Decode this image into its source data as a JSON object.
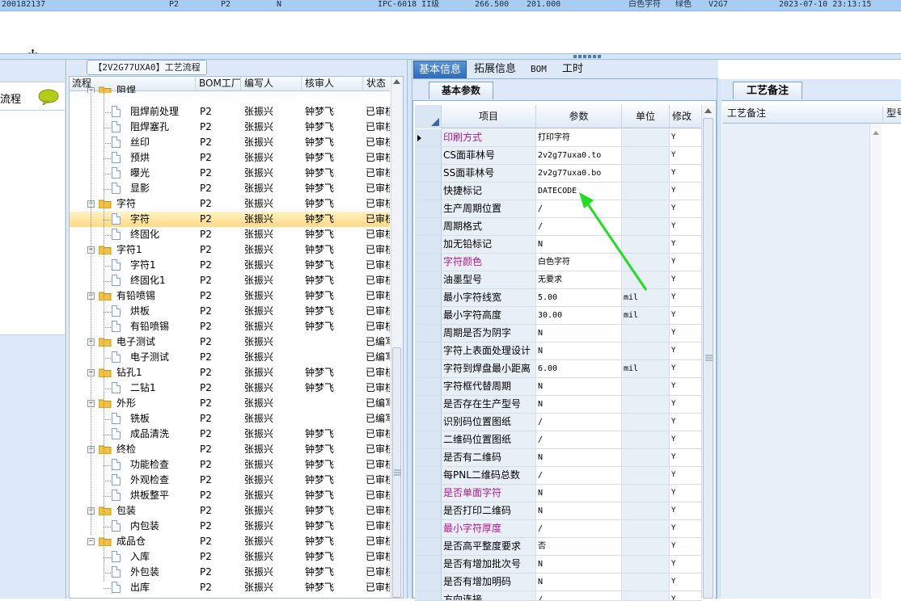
{
  "top_row": {
    "id": "200182137",
    "c1": "P2",
    "c2": "P2",
    "c3": "N",
    "model": "IPC-6018 II级",
    "v1": "266.500",
    "v2": "201.000",
    "char_color": "白色字符",
    "oil": "绿色",
    "code": "V2G7",
    "time": "2023-07-10 23:13:15"
  },
  "left_panel": {
    "label": "流程"
  },
  "tree": {
    "title": "【2V2G77UXA0】工艺流程",
    "columns": [
      "流程",
      "BOM工厂",
      "编写人",
      "核审人",
      "状态"
    ],
    "rows": [
      {
        "lvl": 0,
        "name": "阻焊",
        "bom": "",
        "writer": "",
        "reviewer": "",
        "status": "",
        "partial": true
      },
      {
        "lvl": 1,
        "name": "阻焊前处理",
        "bom": "P2",
        "writer": "张振兴",
        "reviewer": "钟梦飞",
        "status": "已审核"
      },
      {
        "lvl": 1,
        "name": "阻焊塞孔",
        "bom": "P2",
        "writer": "张振兴",
        "reviewer": "钟梦飞",
        "status": "已审核"
      },
      {
        "lvl": 1,
        "name": "丝印",
        "bom": "P2",
        "writer": "张振兴",
        "reviewer": "钟梦飞",
        "status": "已审核"
      },
      {
        "lvl": 1,
        "name": "预烘",
        "bom": "P2",
        "writer": "张振兴",
        "reviewer": "钟梦飞",
        "status": "已审核"
      },
      {
        "lvl": 1,
        "name": "曝光",
        "bom": "P2",
        "writer": "张振兴",
        "reviewer": "钟梦飞",
        "status": "已审核"
      },
      {
        "lvl": 1,
        "name": "显影",
        "bom": "P2",
        "writer": "张振兴",
        "reviewer": "钟梦飞",
        "status": "已审核"
      },
      {
        "lvl": 0,
        "name": "字符",
        "bom": "P2",
        "writer": "张振兴",
        "reviewer": "钟梦飞",
        "status": "已审核"
      },
      {
        "lvl": 1,
        "name": "字符",
        "bom": "P2",
        "writer": "张振兴",
        "reviewer": "钟梦飞",
        "status": "已审核",
        "selected": true
      },
      {
        "lvl": 1,
        "name": "终固化",
        "bom": "P2",
        "writer": "张振兴",
        "reviewer": "钟梦飞",
        "status": "已审核"
      },
      {
        "lvl": 0,
        "name": "字符1",
        "bom": "P2",
        "writer": "张振兴",
        "reviewer": "钟梦飞",
        "status": "已审核"
      },
      {
        "lvl": 1,
        "name": "字符1",
        "bom": "P2",
        "writer": "张振兴",
        "reviewer": "钟梦飞",
        "status": "已审核"
      },
      {
        "lvl": 1,
        "name": "终固化1",
        "bom": "P2",
        "writer": "张振兴",
        "reviewer": "钟梦飞",
        "status": "已审核"
      },
      {
        "lvl": 0,
        "name": "有铅喷锡",
        "bom": "P2",
        "writer": "张振兴",
        "reviewer": "钟梦飞",
        "status": "已审核"
      },
      {
        "lvl": 1,
        "name": "烘板",
        "bom": "P2",
        "writer": "张振兴",
        "reviewer": "钟梦飞",
        "status": "已审核"
      },
      {
        "lvl": 1,
        "name": "有铅喷锡",
        "bom": "P2",
        "writer": "张振兴",
        "reviewer": "钟梦飞",
        "status": "已审核"
      },
      {
        "lvl": 0,
        "name": "电子测试",
        "bom": "P2",
        "writer": "张振兴",
        "reviewer": "",
        "status": "已编写"
      },
      {
        "lvl": 1,
        "name": "电子测试",
        "bom": "P2",
        "writer": "张振兴",
        "reviewer": "",
        "status": "已编写"
      },
      {
        "lvl": 0,
        "name": "钻孔1",
        "bom": "P2",
        "writer": "张振兴",
        "reviewer": "钟梦飞",
        "status": "已审核"
      },
      {
        "lvl": 1,
        "name": "二钻1",
        "bom": "P2",
        "writer": "张振兴",
        "reviewer": "钟梦飞",
        "status": "已审核"
      },
      {
        "lvl": 0,
        "name": "外形",
        "bom": "P2",
        "writer": "张振兴",
        "reviewer": "",
        "status": "已编写"
      },
      {
        "lvl": 1,
        "name": "铣板",
        "bom": "P2",
        "writer": "张振兴",
        "reviewer": "",
        "status": "已编写"
      },
      {
        "lvl": 1,
        "name": "成品清洗",
        "bom": "P2",
        "writer": "张振兴",
        "reviewer": "钟梦飞",
        "status": "已审核"
      },
      {
        "lvl": 0,
        "name": "终检",
        "bom": "P2",
        "writer": "张振兴",
        "reviewer": "钟梦飞",
        "status": "已审核"
      },
      {
        "lvl": 1,
        "name": "功能检查",
        "bom": "P2",
        "writer": "张振兴",
        "reviewer": "钟梦飞",
        "status": "已审核"
      },
      {
        "lvl": 1,
        "name": "外观检查",
        "bom": "P2",
        "writer": "张振兴",
        "reviewer": "钟梦飞",
        "status": "已审核"
      },
      {
        "lvl": 1,
        "name": "烘板整平",
        "bom": "P2",
        "writer": "张振兴",
        "reviewer": "钟梦飞",
        "status": "已审核"
      },
      {
        "lvl": 0,
        "name": "包装",
        "bom": "P2",
        "writer": "张振兴",
        "reviewer": "钟梦飞",
        "status": "已审核"
      },
      {
        "lvl": 1,
        "name": "内包装",
        "bom": "P2",
        "writer": "张振兴",
        "reviewer": "钟梦飞",
        "status": "已审核"
      },
      {
        "lvl": 0,
        "name": "成品仓",
        "bom": "P2",
        "writer": "张振兴",
        "reviewer": "钟梦飞",
        "status": "已审核"
      },
      {
        "lvl": 1,
        "name": "入库",
        "bom": "P2",
        "writer": "张振兴",
        "reviewer": "钟梦飞",
        "status": "已审核"
      },
      {
        "lvl": 1,
        "name": "外包装",
        "bom": "P2",
        "writer": "张振兴",
        "reviewer": "钟梦飞",
        "status": "已审核"
      },
      {
        "lvl": 1,
        "name": "出库",
        "bom": "P2",
        "writer": "张振兴",
        "reviewer": "钟梦飞",
        "status": "已审核"
      }
    ]
  },
  "tabs": [
    "基本信息",
    "拓展信息",
    "BOM",
    "工时"
  ],
  "subtab": "基本参数",
  "grid": {
    "columns": [
      "项目",
      "参数",
      "单位",
      "修改"
    ],
    "rows": [
      {
        "item": "印刷方式",
        "value": "打印字符",
        "unit": "",
        "mod": "Y",
        "purple": true,
        "current": true
      },
      {
        "item": "CS面菲林号",
        "value": "2v2g77uxa0.to",
        "unit": "",
        "mod": "Y"
      },
      {
        "item": "SS面菲林号",
        "value": "2v2g77uxa0.bo",
        "unit": "",
        "mod": "Y"
      },
      {
        "item": "快捷标记",
        "value": "DATECODE",
        "unit": "",
        "mod": "Y"
      },
      {
        "item": "生产周期位置",
        "value": "/",
        "unit": "",
        "mod": "Y"
      },
      {
        "item": "周期格式",
        "value": "/",
        "unit": "",
        "mod": "Y"
      },
      {
        "item": "加无铅标记",
        "value": "N",
        "unit": "",
        "mod": "Y"
      },
      {
        "item": "字符颜色",
        "value": "白色字符",
        "unit": "",
        "mod": "Y",
        "purple": true
      },
      {
        "item": "油墨型号",
        "value": "无要求",
        "unit": "",
        "mod": "Y"
      },
      {
        "item": "最小字符线宽",
        "value": "5.00",
        "unit": "mil",
        "mod": "Y"
      },
      {
        "item": "最小字符高度",
        "value": "30.00",
        "unit": "mil",
        "mod": "Y"
      },
      {
        "item": "周期是否为阴字",
        "value": "N",
        "unit": "",
        "mod": "Y"
      },
      {
        "item": "字符上表面处理设计",
        "value": "N",
        "unit": "",
        "mod": "Y"
      },
      {
        "item": "字符到焊盘最小距离",
        "value": "6.00",
        "unit": "mil",
        "mod": "Y"
      },
      {
        "item": "字符框代替周期",
        "value": "N",
        "unit": "",
        "mod": "Y"
      },
      {
        "item": "是否存在生产型号",
        "value": "N",
        "unit": "",
        "mod": "Y"
      },
      {
        "item": "识别码位置图纸",
        "value": "/",
        "unit": "",
        "mod": "Y"
      },
      {
        "item": "二维码位置图纸",
        "value": "/",
        "unit": "",
        "mod": "Y"
      },
      {
        "item": "是否有二维码",
        "value": "N",
        "unit": "",
        "mod": "Y"
      },
      {
        "item": "每PNL二维码总数",
        "value": "/",
        "unit": "",
        "mod": "Y"
      },
      {
        "item": "是否单面字符",
        "value": "N",
        "unit": "",
        "mod": "Y",
        "purple": true
      },
      {
        "item": "是否打印二维码",
        "value": "N",
        "unit": "",
        "mod": "Y"
      },
      {
        "item": "最小字符厚度",
        "value": "/",
        "unit": "",
        "mod": "Y",
        "purple": true
      },
      {
        "item": "是否高平整度要求",
        "value": "否",
        "unit": "",
        "mod": "Y"
      },
      {
        "item": "是否有增加批次号",
        "value": "N",
        "unit": "",
        "mod": "Y"
      },
      {
        "item": "是否有增加明码",
        "value": "N",
        "unit": "",
        "mod": "Y"
      },
      {
        "item": "方向连接",
        "value": "/",
        "unit": "",
        "mod": "Y",
        "partial": true
      }
    ]
  },
  "notes": {
    "tab": "工艺备注",
    "col1": "工艺备注",
    "col2": "型号"
  },
  "colors": {
    "accent": "#2f6bbd",
    "header_row": "#a9cdf2",
    "panel": "#dde9f8",
    "purple": "#b3178c",
    "selected": "#ffd985",
    "arrow": "#22dd22"
  }
}
